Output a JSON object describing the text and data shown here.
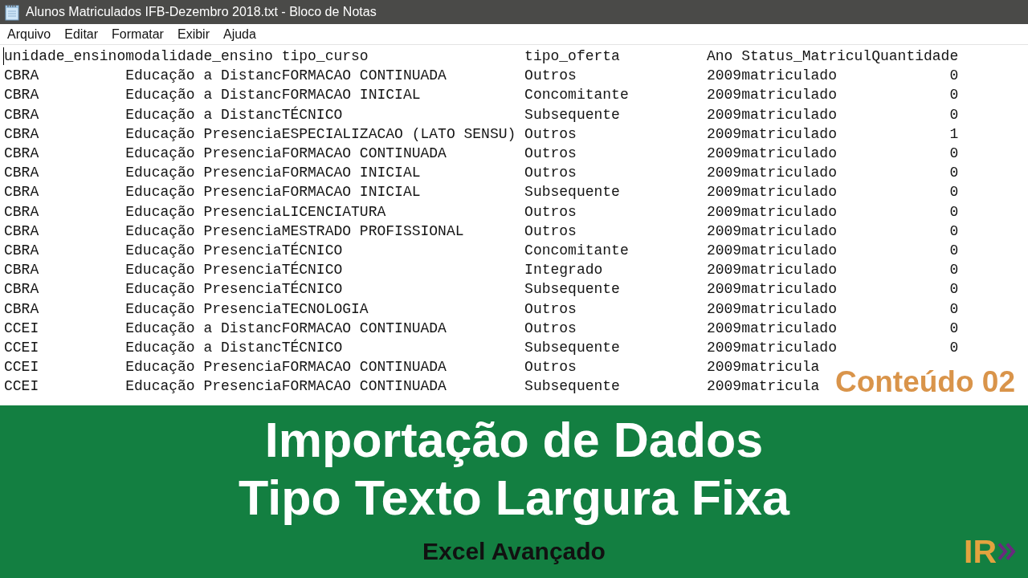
{
  "window": {
    "title": "Alunos Matriculados IFB-Dezembro 2018.txt - Bloco de Notas"
  },
  "menu": [
    "Arquivo",
    "Editar",
    "Formatar",
    "Exibir",
    "Ajuda"
  ],
  "document": {
    "header_line": [
      "unidade_ensino",
      "modalidade_ensino",
      "tipo_curso",
      "tipo_oferta",
      "Ano",
      "Status_Matricul",
      "Quantidade"
    ],
    "rows": [
      [
        "CBRA",
        "Educação a Distanc",
        "FORMACAO CONTINUADA",
        "Outros",
        "2009",
        "matriculado",
        "0"
      ],
      [
        "CBRA",
        "Educação a Distanc",
        "FORMACAO INICIAL",
        "Concomitante",
        "2009",
        "matriculado",
        "0"
      ],
      [
        "CBRA",
        "Educação a Distanc",
        "TÉCNICO",
        "Subsequente",
        "2009",
        "matriculado",
        "0"
      ],
      [
        "CBRA",
        "Educação Presencia",
        "ESPECIALIZACAO (LATO SENSU)",
        "Outros",
        "2009",
        "matriculado",
        "1"
      ],
      [
        "CBRA",
        "Educação Presencia",
        "FORMACAO CONTINUADA",
        "Outros",
        "2009",
        "matriculado",
        "0"
      ],
      [
        "CBRA",
        "Educação Presencia",
        "FORMACAO INICIAL",
        "Outros",
        "2009",
        "matriculado",
        "0"
      ],
      [
        "CBRA",
        "Educação Presencia",
        "FORMACAO INICIAL",
        "Subsequente",
        "2009",
        "matriculado",
        "0"
      ],
      [
        "CBRA",
        "Educação Presencia",
        "LICENCIATURA",
        "Outros",
        "2009",
        "matriculado",
        "0"
      ],
      [
        "CBRA",
        "Educação Presencia",
        "MESTRADO PROFISSIONAL",
        "Outros",
        "2009",
        "matriculado",
        "0"
      ],
      [
        "CBRA",
        "Educação Presencia",
        "TÉCNICO",
        "Concomitante",
        "2009",
        "matriculado",
        "0"
      ],
      [
        "CBRA",
        "Educação Presencia",
        "TÉCNICO",
        "Integrado",
        "2009",
        "matriculado",
        "0"
      ],
      [
        "CBRA",
        "Educação Presencia",
        "TÉCNICO",
        "Subsequente",
        "2009",
        "matriculado",
        "0"
      ],
      [
        "CBRA",
        "Educação Presencia",
        "TECNOLOGIA",
        "Outros",
        "2009",
        "matriculado",
        "0"
      ],
      [
        "CCEI",
        "Educação a Distanc",
        "FORMACAO CONTINUADA",
        "Outros",
        "2009",
        "matriculado",
        "0"
      ],
      [
        "CCEI",
        "Educação a Distanc",
        "TÉCNICO",
        "Subsequente",
        "2009",
        "matriculado",
        "0"
      ],
      [
        "CCEI",
        "Educação Presencia",
        "FORMACAO CONTINUADA",
        "Outros",
        "2009",
        "matricula"
      ],
      [
        "CCEI",
        "Educação Presencia",
        "FORMACAO CONTINUADA",
        "Subsequente",
        "2009",
        "matricula"
      ]
    ]
  },
  "overlay_label": "Conteúdo 02",
  "banner": {
    "title_lines": [
      "Importação de Dados",
      "Tipo Texto Largura Fixa"
    ],
    "subtitle": "Excel Avançado",
    "logo_text": "IR"
  }
}
